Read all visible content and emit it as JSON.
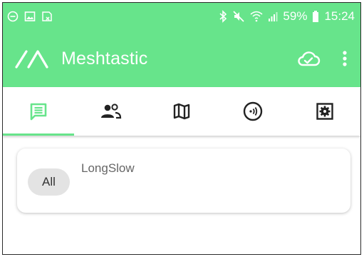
{
  "status_bar": {
    "battery_percent": "59%",
    "time": "15:24",
    "left_icons": [
      "minus-circle-icon",
      "image-icon",
      "screenshot-icon"
    ],
    "right_icons": [
      "bluetooth-icon",
      "mute-icon",
      "wifi-icon",
      "signal-icon",
      "battery-icon"
    ]
  },
  "app_bar": {
    "title": "Meshtastic",
    "icons": [
      "logo-icon",
      "cloud-check-icon",
      "more-vert-icon"
    ]
  },
  "tabs": [
    {
      "icon": "chat-icon",
      "active": true
    },
    {
      "icon": "people-icon",
      "active": false
    },
    {
      "icon": "map-icon",
      "active": false
    },
    {
      "icon": "radio-icon",
      "active": false
    },
    {
      "icon": "settings-icon",
      "active": false
    }
  ],
  "channel_card": {
    "chip_label": "All",
    "channel_name": "LongSlow"
  },
  "colors": {
    "accent": "#67e48b",
    "chip_background": "#e3e3e3",
    "tab_icon": "#222222"
  }
}
